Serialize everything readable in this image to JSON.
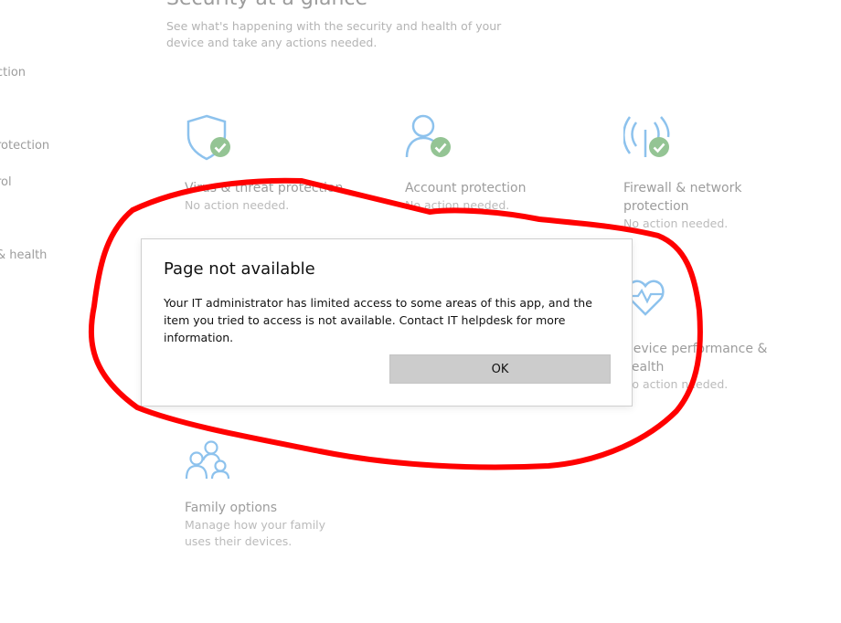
{
  "sidebar": {
    "items": [
      {
        "label": "ction"
      },
      {
        "label": "rotection"
      },
      {
        "label": "rol"
      },
      {
        "label": "& health"
      }
    ]
  },
  "header": {
    "title": "Security at a glance",
    "subtitle": "See what's happening with the security and health of your device and take any actions needed."
  },
  "tiles": [
    {
      "title": "Virus & threat protection",
      "status": "No action needed.",
      "icon": "shield-check-icon"
    },
    {
      "title": "Account protection",
      "status": "No action needed.",
      "icon": "person-check-icon"
    },
    {
      "title": "Firewall & network protection",
      "status": "No action needed.",
      "icon": "antenna-check-icon"
    },
    {
      "title": "Device performance & health",
      "status": "No action needed.",
      "icon": "heart-pulse-icon"
    },
    {
      "title": "Family options",
      "status": "Manage how your family uses their devices.",
      "icon": "family-icon"
    }
  ],
  "dialog": {
    "title": "Page not available",
    "message": "Your IT administrator has limited access to some areas of this app, and the item you tried to access is not available. Contact IT helpdesk for more information.",
    "ok_label": "OK"
  },
  "colors": {
    "icon_blue": "#0078d7",
    "check_green": "#107c10",
    "annotation_red": "#ff0000",
    "button_gray": "#cccccc"
  }
}
